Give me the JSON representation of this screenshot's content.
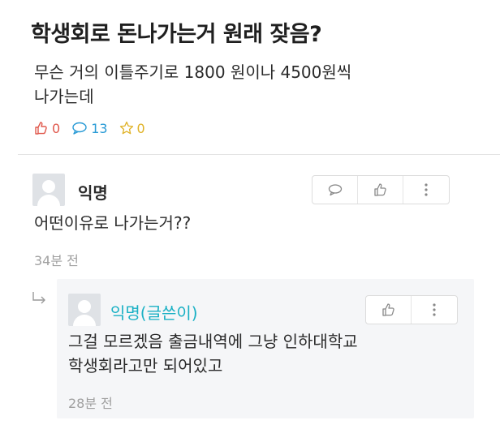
{
  "post": {
    "title": "학생회로 돈나가는거 원래 잦음?",
    "body": "무슨 거의 이틀주기로 1800 원이나 4500원씩\n나가는데",
    "stats": {
      "likes": "0",
      "comments": "13",
      "scraps": "0"
    }
  },
  "comments": [
    {
      "author": "익명",
      "text": "어떤이유로 나가는거??",
      "time": "34분 전",
      "reply": {
        "author": "익명(글쓴이)",
        "text": "그걸 모르겠음 출금내역에 그냥 인하대학교\n학생회라고만 되어있고",
        "time": "28분 전"
      }
    }
  ],
  "colors": {
    "like": "#e0584c",
    "comment": "#2a9bd6",
    "scrap": "#e0b226",
    "writer": "#19b0c4"
  }
}
